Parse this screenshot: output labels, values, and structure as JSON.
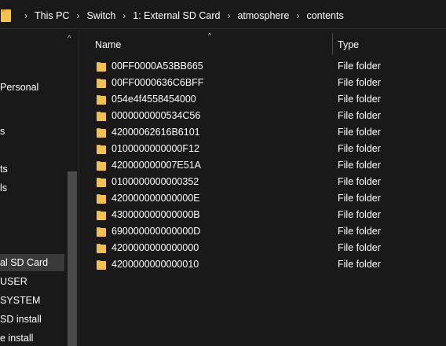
{
  "addressbar": {
    "crumbs": [
      "This PC",
      "Switch",
      "1: External SD Card",
      "atmosphere",
      "contents"
    ],
    "separator": "›"
  },
  "navpane": {
    "collapse_glyph": "^",
    "items": [
      {
        "label": "Personal",
        "selected": false
      },
      {
        "label": "s",
        "selected": false
      },
      {
        "label": "ts",
        "selected": false
      },
      {
        "label": "ls",
        "selected": false
      },
      {
        "label": "al SD Card",
        "selected": true
      },
      {
        "label": "USER",
        "selected": false
      },
      {
        "label": "SYSTEM",
        "selected": false
      },
      {
        "label": "SD install",
        "selected": false
      },
      {
        "label": "e install",
        "selected": false
      }
    ]
  },
  "list": {
    "sort_glyph": "^",
    "columns": {
      "name": "Name",
      "type": "Type"
    },
    "rows": [
      {
        "name": "00FF0000A53BB665",
        "type": "File folder"
      },
      {
        "name": "00FF0000636C6BFF",
        "type": "File folder"
      },
      {
        "name": "054e4f4558454000",
        "type": "File folder"
      },
      {
        "name": "0000000000534C56",
        "type": "File folder"
      },
      {
        "name": "42000062616B6101",
        "type": "File folder"
      },
      {
        "name": "0100000000000F12",
        "type": "File folder"
      },
      {
        "name": "420000000007E51A",
        "type": "File folder"
      },
      {
        "name": "0100000000000352",
        "type": "File folder"
      },
      {
        "name": "420000000000000E",
        "type": "File folder"
      },
      {
        "name": "430000000000000B",
        "type": "File folder"
      },
      {
        "name": "690000000000000D",
        "type": "File folder"
      },
      {
        "name": "4200000000000000",
        "type": "File folder"
      },
      {
        "name": "4200000000000010",
        "type": "File folder"
      }
    ]
  },
  "colors": {
    "background": "#191919",
    "folder": "#f4c24a",
    "text": "#ffffff",
    "selected": "#3a3a3a"
  },
  "icons": {
    "address_folder": "folder-icon",
    "row_folder": "folder-icon"
  }
}
